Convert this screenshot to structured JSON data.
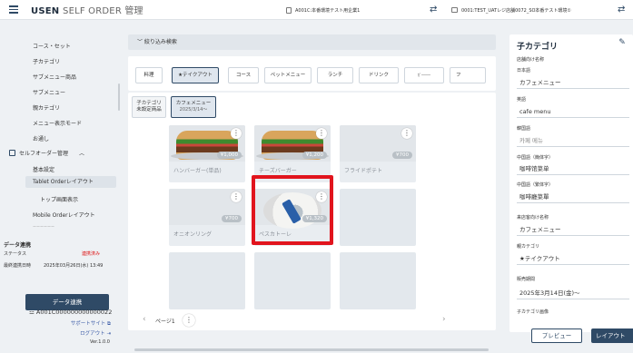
{
  "header": {
    "brand_bold": "USEN",
    "brand_rest": "SELF ORDER 管理",
    "store": "A001C:本番環境テスト用企業1",
    "device": "0001:TEST_UATレジ店舗0072_SO本番テスト環境①"
  },
  "sidebar": {
    "items": [
      "コース・セット",
      "子カテゴリ",
      "サブメニュー商品",
      "サブメニュー",
      "親カテゴリ",
      "メニュー表示モード",
      "お通し"
    ],
    "section": "セルフオーダー管理",
    "sub_items": [
      "基本設定",
      "Tablet Orderレイアウト",
      "トップ画面表示",
      "Mobile Orderレイアウト",
      "ーーーーーー"
    ],
    "sync": {
      "title": "データ連携",
      "status_label": "ステータス",
      "status_value": "連携済み",
      "last_label": "最終連携日時",
      "last_value": "2025年03月26日(水) 13:49",
      "button": "データ連携"
    },
    "account": "A001C000000000000022",
    "support": "サポートサイト",
    "logout": "ログアウト",
    "version": "Ver.1.0.0"
  },
  "main": {
    "filter": "絞り込み検索",
    "tabs": [
      "料理",
      "★テイクアウト",
      "コース",
      "ペットメニュー",
      "ランチ",
      "ドリンク",
      "ｶﾞｰｰｰｰｰ",
      "フ"
    ],
    "subtabs": [
      {
        "line1": "子カテゴリ",
        "line2": "未設定商品"
      },
      {
        "line1": "カフェメニュー",
        "line2": "2025/3/14～"
      }
    ],
    "cards": [
      {
        "name": "ハンバーガー(単品)",
        "price": "¥1,000"
      },
      {
        "name": "チーズバーガー",
        "price": "¥1,200"
      },
      {
        "name": "フライドポテト",
        "price": "¥700"
      },
      {
        "name": "オニオンリング",
        "price": "¥700"
      },
      {
        "name": "ペスカトーレ",
        "price": "¥1,320"
      }
    ],
    "pager": {
      "page": "ページ1"
    }
  },
  "right": {
    "title": "子カテゴリ",
    "label_store_name": "店舗向け名称",
    "label_ja": "日本語",
    "value_ja": "カフェメニュー",
    "label_en": "英語",
    "value_en": "cafe menu",
    "label_ko": "韓国語",
    "value_ko": "카페 메뉴",
    "label_zh_s": "中国語（簡体字）",
    "value_zh_s": "咖啡馆菜单",
    "label_zh_t": "中国語（繁体字）",
    "value_zh_t": "咖啡廳菜單",
    "label_customer": "来店客向け名称",
    "value_customer": "カフェメニュー",
    "label_parent": "親カテゴリ",
    "value_parent": "★テイクアウト",
    "label_period": "販売期間",
    "value_period": "2025年3月14日(金)～",
    "label_image": "子カテゴリ画像",
    "preview_button": "プレビュー",
    "layout_button": "レイアウト"
  },
  "colors": {
    "primary": "#2f4a66",
    "highlight": "#e1141d",
    "status_red": "#dd1111"
  }
}
